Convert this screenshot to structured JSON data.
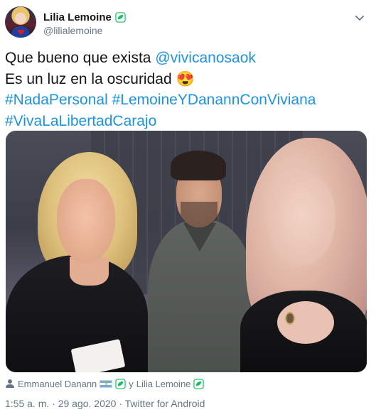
{
  "author": {
    "display_name": "Lilia Lemoine",
    "handle": "@lilialemoine",
    "badge_icon": "green-leaf-icon"
  },
  "tweet": {
    "line1_prefix": "Que bueno que exista ",
    "line1_mention": "@vivicanosaok",
    "line2": "Es un luz en la oscuridad ",
    "line2_emoji": "😍",
    "line3": "#NadaPersonal #LemoineYDanannConViviana",
    "line4": "#VivaLaLibertadCarajo"
  },
  "tagged": {
    "person1": "Emmanuel Danann",
    "joiner": "y",
    "person2": "Lilia Lemoine"
  },
  "meta": {
    "timestamp": "1:55 a. m. · 29 ago. 2020 · Twitter for Android"
  },
  "colors": {
    "link": "#1b95e0",
    "secondary_text": "#657786",
    "primary_text": "#14171a",
    "badge_green": "#17bf63"
  }
}
